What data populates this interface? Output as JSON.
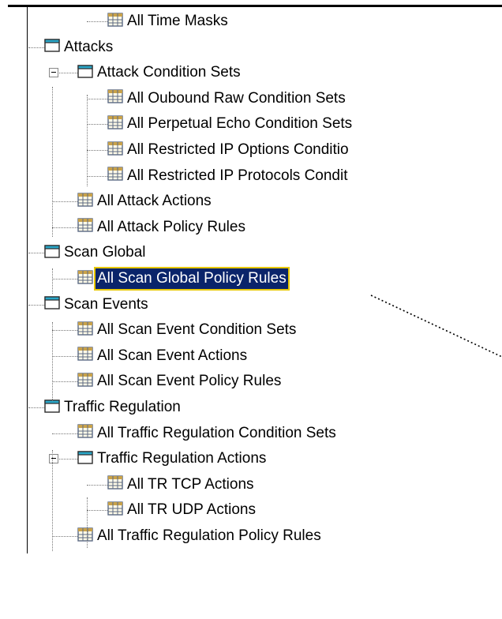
{
  "tree": {
    "items": [
      {
        "label": "All Time Masks",
        "icon": "table-icon",
        "level": 2
      },
      {
        "label": "Attacks",
        "icon": "folder-icon",
        "level": 0
      },
      {
        "label": "Attack Condition Sets",
        "icon": "folder-icon",
        "level": 1,
        "expanded": true
      },
      {
        "label": "All Oubound Raw Condition Sets",
        "icon": "table-icon",
        "level": 2
      },
      {
        "label": "All Perpetual Echo Condition Sets",
        "icon": "table-icon",
        "level": 2
      },
      {
        "label": "All Restricted IP Options Conditio",
        "icon": "table-icon",
        "level": 2
      },
      {
        "label": "All Restricted IP Protocols Condit",
        "icon": "table-icon",
        "level": 2
      },
      {
        "label": "All Attack Actions",
        "icon": "table-icon",
        "level": 1
      },
      {
        "label": "All Attack Policy Rules",
        "icon": "table-icon",
        "level": 1
      },
      {
        "label": "Scan Global",
        "icon": "folder-icon",
        "level": 0
      },
      {
        "label": "All Scan Global Policy Rules",
        "icon": "table-icon",
        "level": 1,
        "selected": true
      },
      {
        "label": "Scan Events",
        "icon": "folder-icon",
        "level": 0
      },
      {
        "label": "All Scan Event Condition Sets",
        "icon": "table-icon",
        "level": 1
      },
      {
        "label": "All Scan Event Actions",
        "icon": "table-icon",
        "level": 1
      },
      {
        "label": "All Scan Event Policy Rules",
        "icon": "table-icon",
        "level": 1
      },
      {
        "label": "Traffic Regulation",
        "icon": "folder-icon",
        "level": 0
      },
      {
        "label": "All Traffic Regulation Condition Sets",
        "icon": "table-icon",
        "level": 1
      },
      {
        "label": "Traffic Regulation Actions",
        "icon": "folder-icon",
        "level": 1,
        "expanded": true
      },
      {
        "label": "All TR TCP Actions",
        "icon": "table-icon",
        "level": 2
      },
      {
        "label": "All TR UDP Actions",
        "icon": "table-icon",
        "level": 2
      },
      {
        "label": "All Traffic Regulation Policy Rules",
        "icon": "table-icon",
        "level": 1
      }
    ]
  },
  "colors": {
    "selection_bg": "#0a246a",
    "selection_border": "#e8c800",
    "folder_tab": "#2aa7c8",
    "table_grid": "#5b6a84"
  }
}
